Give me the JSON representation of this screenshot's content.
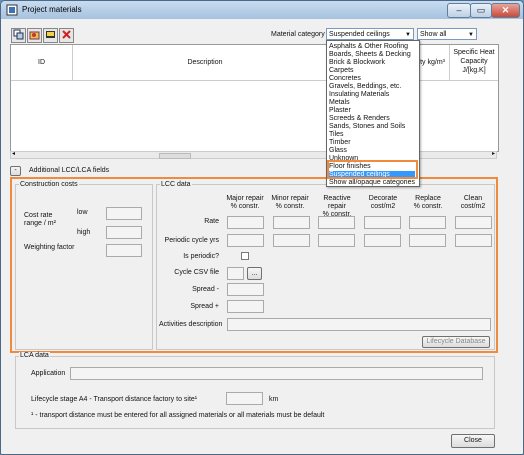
{
  "window": {
    "title": "Project materials",
    "min": "‒",
    "max": "▭",
    "close": "✕"
  },
  "toolbar": {
    "icons": [
      "copy-icon",
      "open-icon",
      "report-icon",
      "delete-icon"
    ]
  },
  "category": {
    "label": "Material category",
    "selected": "Suspended ceilings",
    "filter": "Show all"
  },
  "grid": {
    "columns": [
      {
        "label": "ID"
      },
      {
        "label": "Description"
      },
      {
        "label": "ity kg/m³"
      },
      {
        "label": "Specific Heat\nCapacity\nJ/[kg.K]"
      }
    ]
  },
  "category_list": {
    "items": [
      "Asphalts & Other Roofing",
      "Boards, Sheets & Decking",
      "Brick & Blockwork",
      "Carpets",
      "Concretes",
      "Gravels, Beddings, etc.",
      "Insulating Materials",
      "Metals",
      "Plaster",
      "Screeds & Renders",
      "Sands, Stones and Soils",
      "Tiles",
      "Timber",
      "Glass",
      "Unknown",
      "Floor finishes",
      "Suspended ceilings",
      "Show all/opaque categories"
    ],
    "selected_index": 16
  },
  "lcc_toggle": {
    "label": "Additional LCC/LCA fields"
  },
  "construction": {
    "title": "Construction costs",
    "cost_rate": "Cost rate",
    "range": "range / m²",
    "low": "low",
    "high": "high",
    "weighting": "Weighting factor"
  },
  "lcc": {
    "title": "LCC data",
    "columns": [
      "Major repair\n% constr.",
      "Minor repair\n% constr.",
      "Reactive repair\n% constr.",
      "Decorate\ncost/m2",
      "Replace\n% constr.",
      "Clean\ncost/m2"
    ],
    "rate": "Rate",
    "periodic": "Periodic cycle yrs",
    "is_periodic": "Is periodic?",
    "cycle_csv": "Cycle CSV file",
    "browse": "...",
    "spread_minus": "Spread -",
    "spread_plus": "Spread +",
    "activities": "Activities description",
    "lifecycle_btn": "Lifecycle Database"
  },
  "lca": {
    "title": "LCA data",
    "application": "Application",
    "stage_a4": "Lifecycle stage A4 - Transport distance factory to site¹",
    "km": "km",
    "footnote": "¹ - transport distance must be entered for all assigned materials or all materials must be default"
  },
  "close_btn": "Close",
  "colors": {
    "highlight": "#f08a3c",
    "selection": "#3399ff"
  }
}
